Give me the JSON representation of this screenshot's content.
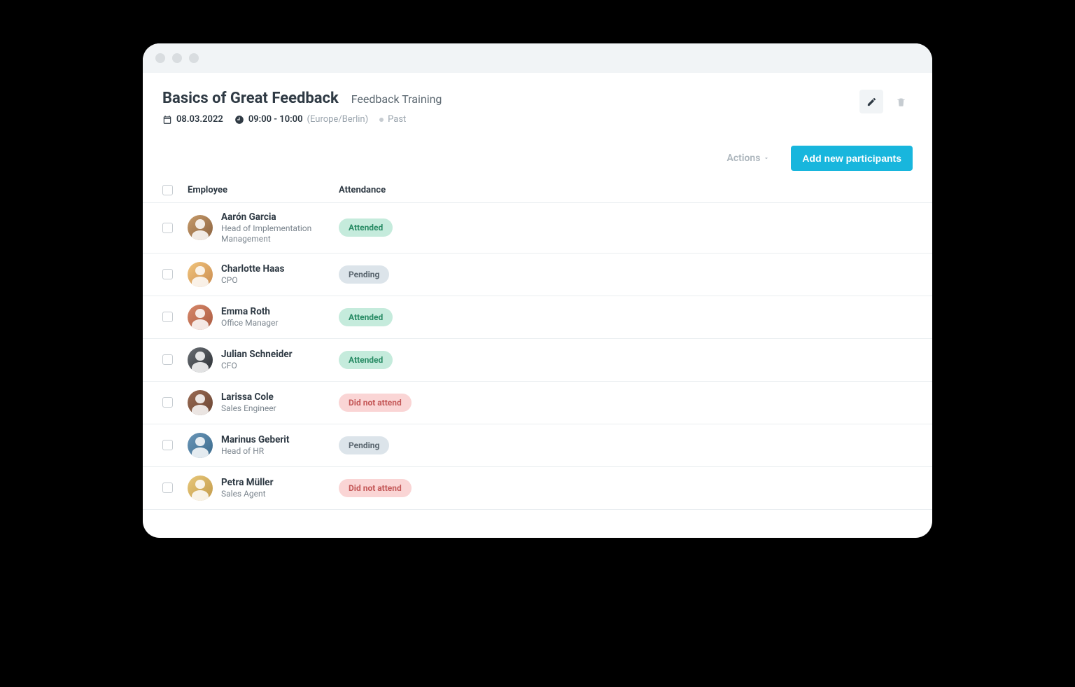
{
  "header": {
    "title": "Basics of Great Feedback",
    "subtitle": "Feedback Training",
    "date": "08.03.2022",
    "time": "09:00 - 10:00",
    "timezone": "(Europe/Berlin)",
    "status": "Past"
  },
  "toolbar": {
    "actions_label": "Actions",
    "add_participants_label": "Add new participants"
  },
  "table": {
    "columns": {
      "employee": "Employee",
      "attendance": "Attendance"
    },
    "badge_labels": {
      "attended": "Attended",
      "pending": "Pending",
      "did_not_attend": "Did not attend"
    }
  },
  "participants": [
    {
      "name": "Aarón Garcia",
      "role": "Head of Implementation Management",
      "status": "attended"
    },
    {
      "name": "Charlotte Haas",
      "role": "CPO",
      "status": "pending"
    },
    {
      "name": "Emma Roth",
      "role": "Office Manager",
      "status": "attended"
    },
    {
      "name": "Julian Schneider",
      "role": "CFO",
      "status": "attended"
    },
    {
      "name": "Larissa Cole",
      "role": "Sales Engineer",
      "status": "did_not_attend"
    },
    {
      "name": "Marinus Geberit",
      "role": "Head of HR",
      "status": "pending"
    },
    {
      "name": "Petra Müller",
      "role": "Sales Agent",
      "status": "did_not_attend"
    }
  ]
}
